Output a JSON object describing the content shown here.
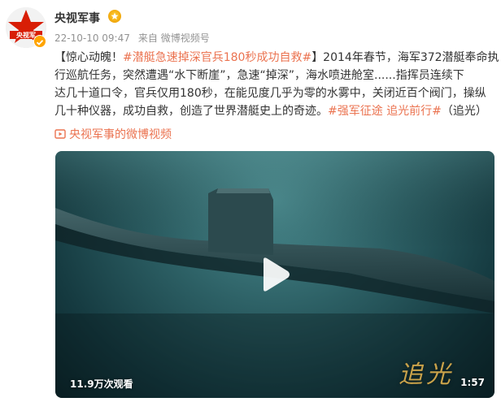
{
  "post": {
    "author": "央视军事",
    "time": "22-10-10 09:47",
    "source_prefix": "来自",
    "source": "微博视频号"
  },
  "content": {
    "line1_pre": "【惊心动魄！",
    "line1_tag": "#潜艇急速掉深官兵180秒成功自救#",
    "line1_post": "】2014年春节，海军372潜艇奉命执",
    "line2": "行巡航任务，突然遭遇“水下断崖”，急速“掉深”，海水喷进舱室......指挥员连续下",
    "line3": "达几十道口令，官兵仅用180秒，在能见度几乎为零的水雾中，关闭近百个阀门，操纵",
    "line4_pre": "几十种仪器，成功自救，创造了世界潜艇史上的奇迹。",
    "line4_tag1": "#强军征途",
    "line4_tag2": "追光前行#",
    "line4_post": "（追光）"
  },
  "video_link": {
    "label": "央视军事的微博视频"
  },
  "video": {
    "views": "11.9万次观看",
    "duration": "1:57",
    "watermark": "追光"
  },
  "colors": {
    "link": "#eb7350",
    "meta": "#939393",
    "verify": "#ffa400",
    "water": "#2c5f64"
  },
  "icons": {
    "avatar": "cctv-military-star-logo",
    "verify": "verified-badge-icon",
    "medal": "medal-icon",
    "video_link": "video-icon",
    "play": "play-icon"
  }
}
